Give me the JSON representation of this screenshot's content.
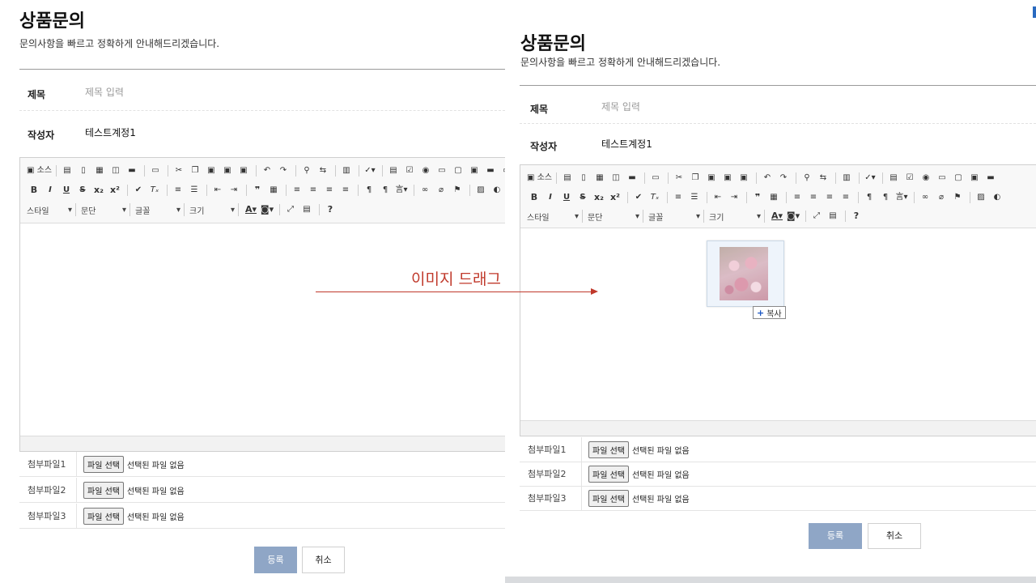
{
  "left_form": {
    "title": "상품문의",
    "subtitle": "문의사항을 빠르고 정확하게 안내해드리겠습니다.",
    "subject_label": "제목",
    "subject_placeholder": "제목 입력",
    "author_label": "작성자",
    "author_value": "테스트계정1",
    "toolbar_row1": [
      "소스",
      "B"
    ],
    "toolbar_combos": [
      "스타일",
      "문단",
      "글꼴",
      "크기"
    ],
    "attachments": [
      {
        "label": "첨부파일1",
        "button": "파일 선택",
        "status": "선택된 파일 없음"
      },
      {
        "label": "첨부파일2",
        "button": "파일 선택",
        "status": "선택된 파일 없음"
      },
      {
        "label": "첨부파일3",
        "button": "파일 선택",
        "status": "선택된 파일 없음"
      }
    ],
    "submit_label": "등록",
    "cancel_label": "취소"
  },
  "right_form": {
    "title": "상품문의",
    "subtitle": "문의사항을 빠르고 정확하게 안내해드리겠습니다.",
    "subject_label": "제목",
    "subject_placeholder": "제목 입력",
    "author_label": "작성자",
    "author_value": "테스트계정1",
    "toolbar_combos": [
      "스타일",
      "문단",
      "글꼴",
      "크기"
    ],
    "attachments": [
      {
        "label": "첨부파일1",
        "button": "파일 선택",
        "status": "선택된 파일 없음"
      },
      {
        "label": "첨부파일2",
        "button": "파일 선택",
        "status": "선택된 파일 없음"
      },
      {
        "label": "첨부파일3",
        "button": "파일 선택",
        "status": "선택된 파일 없음"
      }
    ],
    "submit_label": "등록",
    "cancel_label": "취소",
    "copy_tag": "복사"
  },
  "annotation": {
    "text": "이미지 드래그",
    "color": "#c0392b"
  },
  "colors": {
    "submit_bg": "#8fa6c6",
    "divider": "#9a9a9a"
  }
}
